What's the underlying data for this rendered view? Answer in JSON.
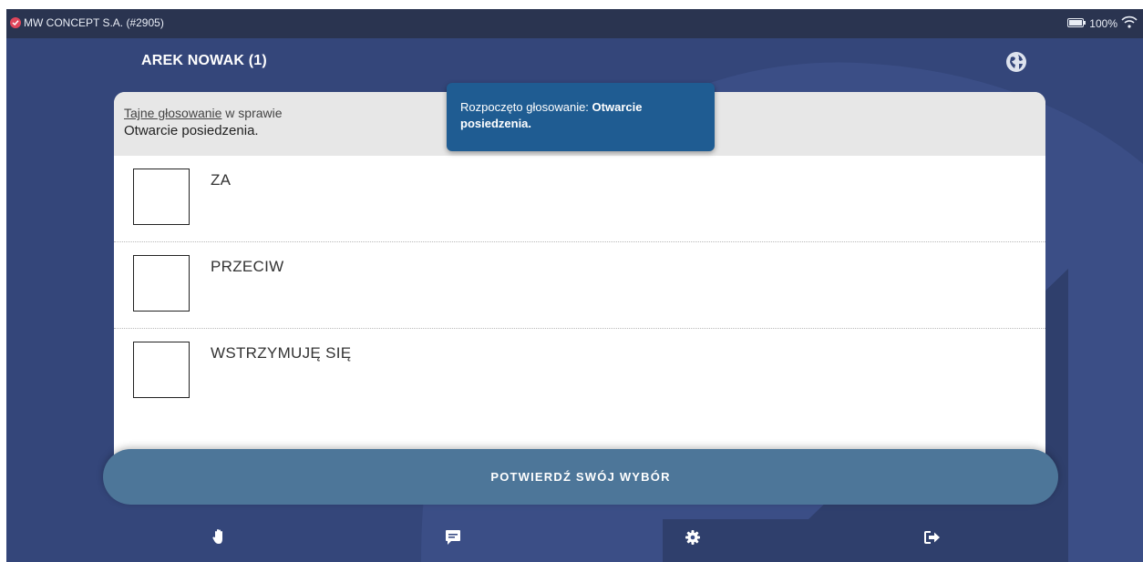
{
  "statusbar": {
    "title": "MW CONCEPT S.A. (#2905)",
    "battery": "100%"
  },
  "header": {
    "user": "AREK NOWAK (1)"
  },
  "card": {
    "vote_type": "Tajne głosowanie",
    "vote_suffix": " w sprawie",
    "subject": "Otwarcie posiedzenia."
  },
  "toast": {
    "prefix": "Rozpoczęto głosowanie: ",
    "subject": "Otwarcie posiedzenia."
  },
  "options": [
    {
      "label": "ZA",
      "checked": false
    },
    {
      "label": "PRZECIW",
      "checked": false
    },
    {
      "label": "WSTRZYMUJĘ SIĘ",
      "checked": false
    }
  ],
  "confirm_label": "POTWIERDŹ SWÓJ WYBÓR",
  "bottom_nav": [
    {
      "icon": "hand-icon"
    },
    {
      "icon": "chat-icon"
    },
    {
      "icon": "gear-icon"
    },
    {
      "icon": "logout-icon"
    }
  ],
  "colors": {
    "background": "#34467a",
    "statusbar": "#2a3450",
    "toast": "#1f5c92",
    "confirm_button": "#4d7699",
    "status_dot": "#e0465b"
  }
}
